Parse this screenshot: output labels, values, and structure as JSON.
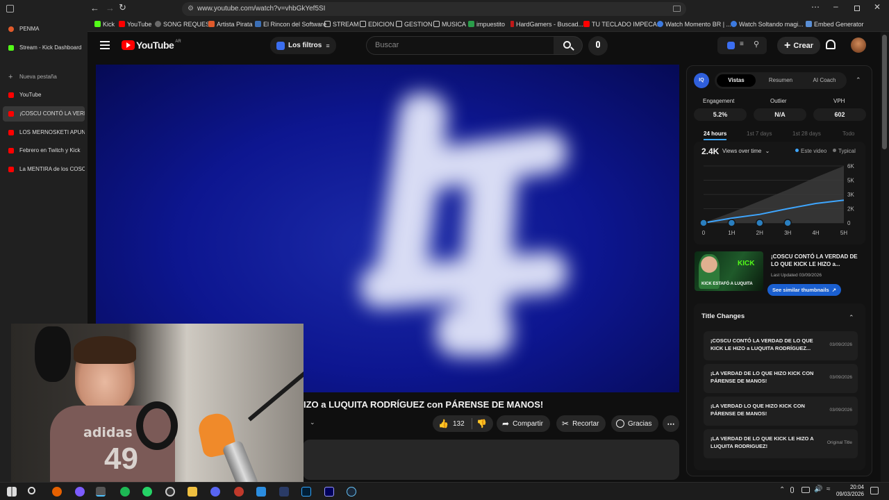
{
  "browser": {
    "url": "www.youtube.com/watch?v=vhbGkYef5SI",
    "bookmarks": [
      "Kick",
      "YouTube",
      "SONG REQUEST",
      "Artista Pirata",
      "El Rincon del Software",
      "STREAM",
      "EDICION",
      "GESTION",
      "MUSICA",
      "impuestito",
      "HardGamers - Buscad...",
      "TU TECLADO IMPECA...",
      "Watch Momento BR | ...",
      "Watch Soltando magi...",
      "Embed Generator"
    ],
    "sidebar_tabs": [
      "PENMA",
      "Stream - Kick Dashboard",
      "Nueva pestaña",
      "YouTube",
      "¡COSCU CONTÓ LA VERDAD",
      "LOS MERNOSKETI APUN",
      "Febrero en Twitch y Kick",
      "La MENTIRA de los COSC"
    ]
  },
  "youtube": {
    "logo": "YouTube",
    "country": "AR",
    "filters_label": "Los filtros",
    "search_placeholder": "Buscar",
    "create_label": "Crear"
  },
  "video": {
    "title_partial": "IZO a LUQUITA RODRÍGUEZ con PÁRENSE DE MANOS!",
    "likes": "132",
    "share_label": "Compartir",
    "clip_label": "Recortar",
    "thanks_label": "Gracias"
  },
  "panel": {
    "tabs": [
      "Vistas",
      "Resumen",
      "AI Coach"
    ],
    "metrics": [
      {
        "label": "Engagement",
        "value": "5.2%"
      },
      {
        "label": "Outlier",
        "value": "N/A"
      },
      {
        "label": "VPH",
        "value": "602"
      }
    ],
    "time_tabs": [
      "24 hours",
      "1st 7 days",
      "1st 28 days",
      "Todo"
    ],
    "views_value": "2.4K",
    "views_label": "Views over time",
    "legend": [
      "Este video",
      "Typical"
    ],
    "thumbnail": {
      "title": "¡COSCU CONTÓ LA VERDAD DE LO QUE KICK LE HIZO a...",
      "updated": "Last Updated 03/09/2026",
      "similar_label": "See similar thumbnails",
      "caption": "KICK ESTAFÓ A LUQUITA",
      "badge": "KICK"
    },
    "title_changes_header": "Title Changes",
    "title_changes": [
      {
        "title": "¡COSCU CONTÓ LA VERDAD DE LO QUE KICK LE HIZO a LUQUITA RODRÍGUEZ...",
        "date": "03/09/2026"
      },
      {
        "title": "¡LA VERDAD DE LO QUE HIZO KICK CON PÁRENSE DE MANOS!",
        "date": "03/09/2026"
      },
      {
        "title": "¡LA VERDAD LO QUE HIZO KICK CON PÁRENSE DE MANOS!",
        "date": "03/09/2026"
      },
      {
        "title": "¡LA VERDAD DE LO QUE KICK LE HIZO A LUQUITA RODRIGUEZ!",
        "date": "Original Title"
      }
    ]
  },
  "chart_data": {
    "type": "area",
    "x": [
      "0",
      "1H",
      "2H",
      "3H",
      "4H",
      "5H"
    ],
    "ylabels": [
      "0",
      "2K",
      "3K",
      "5K",
      "6K"
    ],
    "series": [
      {
        "name": "Este video",
        "values": [
          0,
          500,
          900,
          1500,
          2050,
          2400
        ]
      },
      {
        "name": "Typical",
        "values": [
          0,
          1100,
          2300,
          3500,
          4800,
          6000
        ]
      }
    ],
    "ylim": [
      0,
      6000
    ]
  },
  "taskbar": {
    "time": "20:04",
    "date": "09/03/2026"
  }
}
